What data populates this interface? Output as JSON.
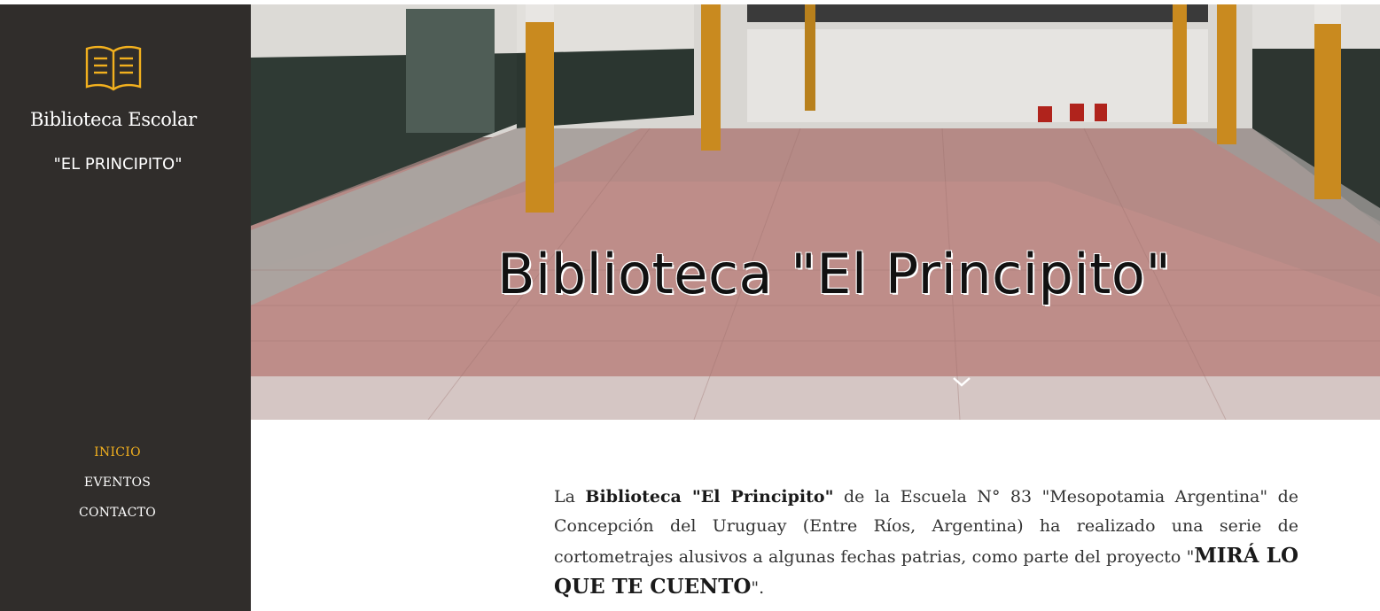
{
  "sidebar": {
    "logo_icon": "open-book-icon",
    "title": "Biblioteca Escolar",
    "subtitle": "\"EL PRINCIPITO\"",
    "nav": [
      {
        "label": "INICIO",
        "active": true
      },
      {
        "label": "EVENTOS",
        "active": false
      },
      {
        "label": "CONTACTO",
        "active": false
      }
    ],
    "accent_color": "#f2b01e",
    "background_color": "#302d2b"
  },
  "hero": {
    "title": "Biblioteca \"El Principito\"",
    "scroll_icon": "chevron-down-icon"
  },
  "content": {
    "p_start": "La ",
    "p_bold": "Biblioteca \"El Principito\"",
    "p_middle": " de la Escuela N° 83 \"Mesopotamia Argentina\" de Concepción del Uruguay (Entre Ríos, Argentina) ha realizado una serie de cortometrajes alusivos a algunas fechas patrias, como parte del proyecto  \"",
    "p_project": "MIRÁ LO QUE TE CUENTO",
    "p_end": "\"."
  }
}
